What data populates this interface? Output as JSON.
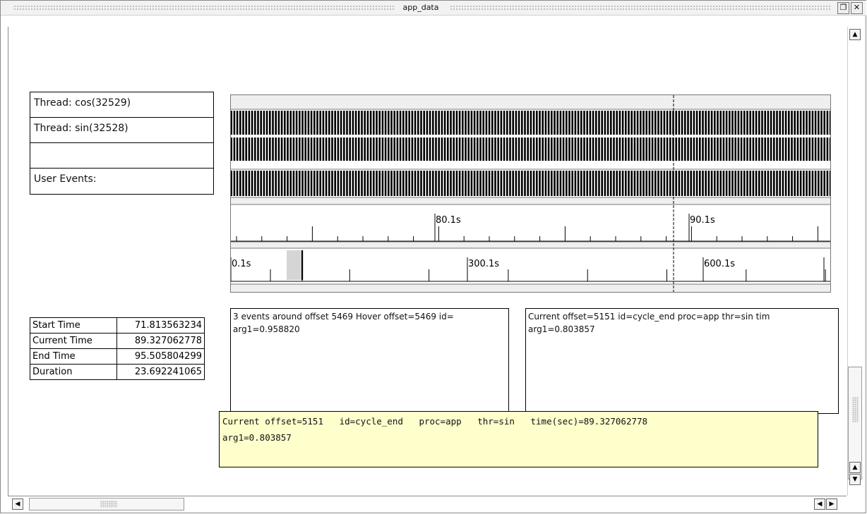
{
  "window": {
    "title": "app_data",
    "restore_icon": "restore-window-icon",
    "close_icon": "close-window-icon"
  },
  "thread_labels": [
    "Thread: cos(32529)",
    "Thread: sin(32528)",
    "",
    "User Events:"
  ],
  "timeline": {
    "zoom_axis": {
      "labels": [
        "80.1s",
        "90.1s"
      ]
    },
    "overview_axis": {
      "labels": [
        "0.1s",
        "300.1s",
        "600.1s"
      ]
    }
  },
  "stats": [
    {
      "key": "Start Time",
      "value": "71.813563234"
    },
    {
      "key": "Current Time",
      "value": "89.327062778"
    },
    {
      "key": "End Time",
      "value": "95.505804299"
    },
    {
      "key": "Duration",
      "value": "23.692241065"
    }
  ],
  "events_box": {
    "line1": "3 events around offset 5469  Hover offset=5469  id=",
    "line2": "arg1=0.958820"
  },
  "current_box": {
    "line1": "Current offset=5151  id=cycle_end  proc=app  thr=sin  tim",
    "line2": "arg1=0.803857"
  },
  "tooltip": {
    "line1": "Current offset=5151   id=cycle_end   proc=app   thr=sin   time(sec)=89.327062778",
    "line2": "arg1=0.803857"
  },
  "scrollbars": {
    "up_icon": "arrow-up-icon",
    "down_icon": "arrow-down-icon",
    "left_icon": "arrow-left-icon",
    "right_icon": "arrow-right-icon"
  }
}
